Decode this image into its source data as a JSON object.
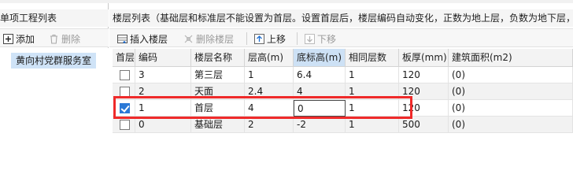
{
  "left": {
    "title": "单项工程列表",
    "add_label": "添加",
    "delete_label": "删除",
    "items": [
      {
        "label": "黄向村党群服务室"
      }
    ]
  },
  "right": {
    "title": "楼层列表（基础层和标准层不能设置为首层。设置首层后，楼层编码自动变化，正数为地上层，负数为地下层，",
    "toolbar": {
      "insert_label": "插入楼层",
      "delete_label": "删除楼层",
      "up_label": "上移",
      "down_label": "下移"
    },
    "columns": [
      "首层",
      "编码",
      "楼层名称",
      "层高(m)",
      "底标高(m)",
      "相同层数",
      "板厚(mm)",
      "建筑面积(m2)"
    ],
    "rows": [
      {
        "checked": false,
        "code": "3",
        "name": "第三层",
        "height": "1",
        "bottom": "6.4",
        "same": "1",
        "slab": "120",
        "area": "(0)"
      },
      {
        "checked": false,
        "code": "2",
        "name": "天面",
        "height": "2.4",
        "bottom": "4",
        "same": "1",
        "slab": "120",
        "area": "(0)"
      },
      {
        "checked": true,
        "code": "1",
        "name": "首层",
        "height": "4",
        "bottom": "0",
        "same": "1",
        "slab": "120",
        "area": "(0)"
      },
      {
        "checked": false,
        "code": "0",
        "name": "基础层",
        "height": "2",
        "bottom": "-2",
        "same": "1",
        "slab": "500",
        "area": "(0)"
      }
    ]
  },
  "colors": {
    "highlight_box": "#ef2a2a",
    "selected_item_bg": "#cfe3f7",
    "header_highlight": "#cde1f5",
    "checkbox_on": "#2b79d6"
  }
}
